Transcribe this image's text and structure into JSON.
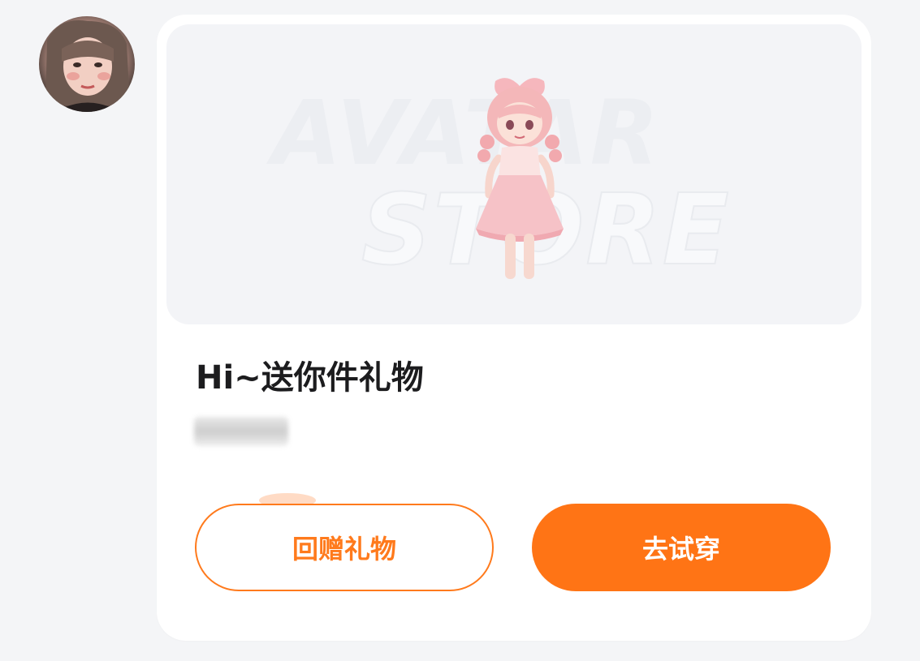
{
  "message": {
    "avatar_icon": "user-avatar",
    "banner": {
      "watermark_line1": "AVATAR",
      "watermark_line2": "STORE",
      "image": "pink-outfit-avatar-figure"
    },
    "title": "Hi~送你件礼物",
    "sender_name_blurred": true,
    "buttons": {
      "return_gift_label": "回赠礼物",
      "try_on_label": "去试穿"
    },
    "colors": {
      "accent": "#ff7415",
      "card_bg": "#ffffff",
      "page_bg": "#f4f5f7"
    }
  }
}
